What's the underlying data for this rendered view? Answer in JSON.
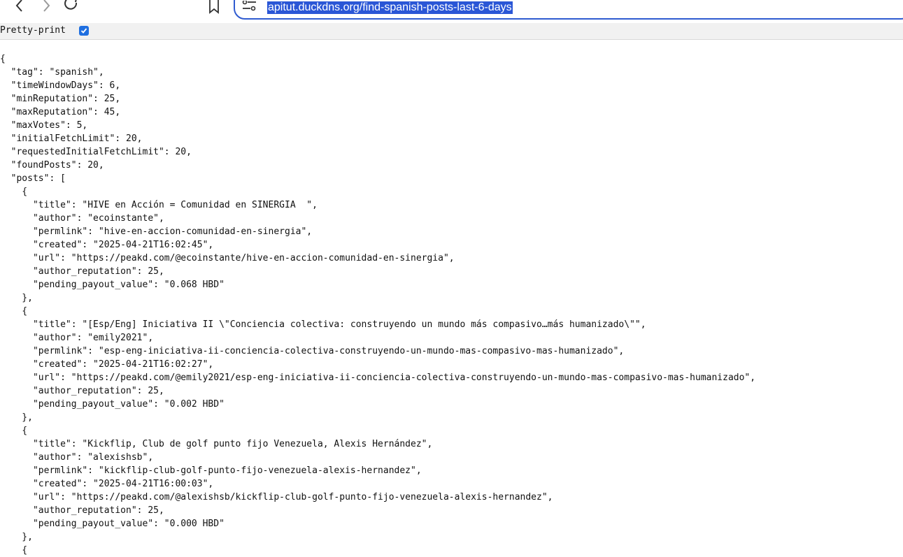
{
  "browser": {
    "url": "apitut.duckdns.org/find-spanish-posts-last-6-days",
    "icons": {
      "back": "back-arrow-icon",
      "forward": "forward-arrow-icon",
      "reload": "reload-icon",
      "bookmark": "bookmark-icon",
      "site_settings": "tune-icon"
    }
  },
  "pretty_print": {
    "label": "Pretty-print",
    "checked": true
  },
  "json_lines": [
    "{",
    "  \"tag\": \"spanish\",",
    "  \"timeWindowDays\": 6,",
    "  \"minReputation\": 25,",
    "  \"maxReputation\": 45,",
    "  \"maxVotes\": 5,",
    "  \"initialFetchLimit\": 20,",
    "  \"requestedInitialFetchLimit\": 20,",
    "  \"foundPosts\": 20,",
    "  \"posts\": [",
    "    {",
    "      \"title\": \"HIVE en Acción = Comunidad en SINERGIA  \",",
    "      \"author\": \"ecoinstante\",",
    "      \"permlink\": \"hive-en-accion-comunidad-en-sinergia\",",
    "      \"created\": \"2025-04-21T16:02:45\",",
    "      \"url\": \"https://peakd.com/@ecoinstante/hive-en-accion-comunidad-en-sinergia\",",
    "      \"author_reputation\": 25,",
    "      \"pending_payout_value\": \"0.068 HBD\"",
    "    },",
    "    {",
    "      \"title\": \"[Esp/Eng] Iniciativa II \\\"Conciencia colectiva: construyendo un mundo más compasivo…más humanizado\\\"\",",
    "      \"author\": \"emily2021\",",
    "      \"permlink\": \"esp-eng-iniciativa-ii-conciencia-colectiva-construyendo-un-mundo-mas-compasivo-mas-humanizado\",",
    "      \"created\": \"2025-04-21T16:02:27\",",
    "      \"url\": \"https://peakd.com/@emily2021/esp-eng-iniciativa-ii-conciencia-colectiva-construyendo-un-mundo-mas-compasivo-mas-humanizado\",",
    "      \"author_reputation\": 25,",
    "      \"pending_payout_value\": \"0.002 HBD\"",
    "    },",
    "    {",
    "      \"title\": \"Kickflip, Club de golf punto fijo Venezuela, Alexis Hernández\",",
    "      \"author\": \"alexishsb\",",
    "      \"permlink\": \"kickflip-club-golf-punto-fijo-venezuela-alexis-hernandez\",",
    "      \"created\": \"2025-04-21T16:00:03\",",
    "      \"url\": \"https://peakd.com/@alexishsb/kickflip-club-golf-punto-fijo-venezuela-alexis-hernandez\",",
    "      \"author_reputation\": 25,",
    "      \"pending_payout_value\": \"0.000 HBD\"",
    "    },",
    "    {"
  ]
}
